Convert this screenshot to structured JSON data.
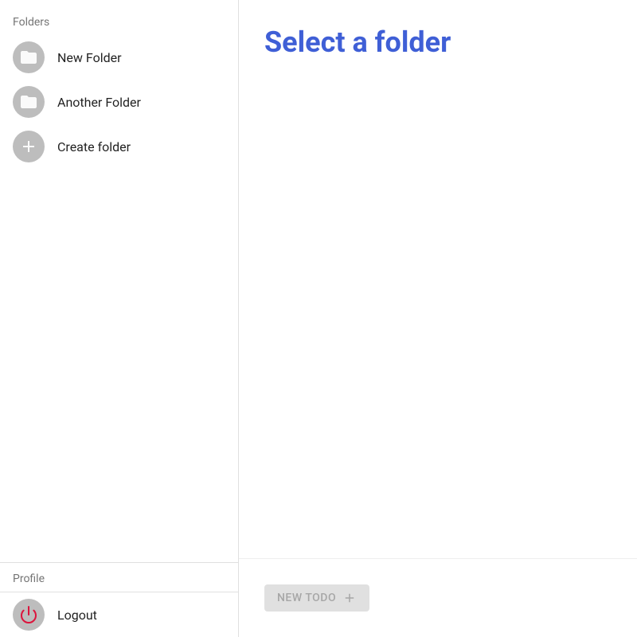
{
  "sidebar": {
    "folders_header": "Folders",
    "items": [
      {
        "label": "New Folder"
      },
      {
        "label": "Another Folder"
      }
    ],
    "create_label": "Create folder",
    "profile_header": "Profile",
    "logout_label": "Logout"
  },
  "main": {
    "title": "Select a folder",
    "new_todo_label": "NEW TODO"
  }
}
